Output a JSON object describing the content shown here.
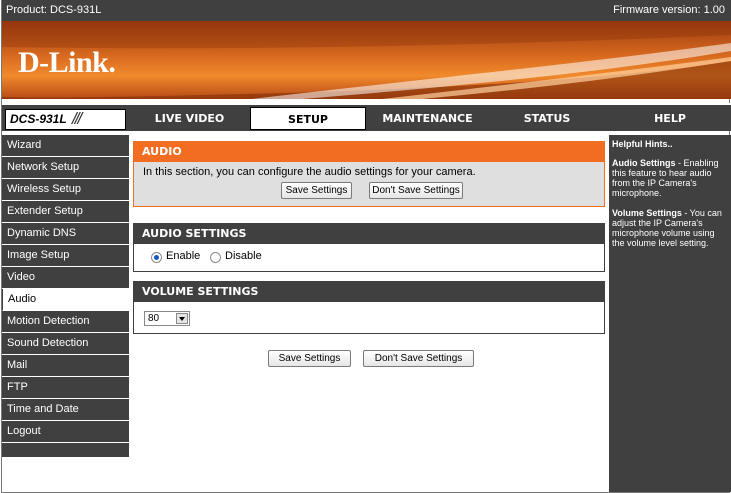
{
  "topbar": {
    "product": "Product: DCS-931L",
    "firmware": "Firmware version: 1.00"
  },
  "brand": {
    "logo_text": "D-Link",
    "model": "DCS-931L",
    "slashes": "///"
  },
  "nav": {
    "tabs": [
      {
        "label": "LIVE VIDEO",
        "active": false
      },
      {
        "label": "SETUP",
        "active": true
      },
      {
        "label": "MAINTENANCE",
        "active": false
      },
      {
        "label": "STATUS",
        "active": false
      },
      {
        "label": "HELP",
        "active": false
      }
    ]
  },
  "sidebar": {
    "items": [
      {
        "label": "Wizard"
      },
      {
        "label": "Network Setup"
      },
      {
        "label": "Wireless Setup"
      },
      {
        "label": "Extender Setup"
      },
      {
        "label": "Dynamic DNS"
      },
      {
        "label": "Image Setup"
      },
      {
        "label": "Video"
      },
      {
        "label": "Audio",
        "active": true
      },
      {
        "label": "Motion Detection"
      },
      {
        "label": "Sound Detection"
      },
      {
        "label": "Mail"
      },
      {
        "label": "FTP"
      },
      {
        "label": "Time and Date"
      },
      {
        "label": "Logout"
      }
    ]
  },
  "audio_section": {
    "title": "AUDIO",
    "description": "In this section, you can configure the audio settings for your camera.",
    "save_label": "Save Settings",
    "dont_save_label": "Don't Save Settings"
  },
  "audio_settings": {
    "title": "AUDIO SETTINGS",
    "enable_label": "Enable",
    "disable_label": "Disable",
    "selected": "Enable"
  },
  "volume_settings": {
    "title": "VOLUME SETTINGS",
    "value": "80"
  },
  "footer_buttons": {
    "save_label": "Save Settings",
    "dont_save_label": "Don't Save Settings"
  },
  "hints": {
    "title": "Helpful Hints..",
    "audio_term": "Audio Settings",
    "audio_text": " - Enabling this feature to hear audio from the IP Camera's microphone.",
    "volume_term": "Volume Settings",
    "volume_text": " - You can adjust the IP Camera's microphone volume using the volume level setting."
  },
  "colors": {
    "accent_orange": "#f26d21",
    "dark_gray": "#404040",
    "intro_bg": "#dfdfdf"
  }
}
